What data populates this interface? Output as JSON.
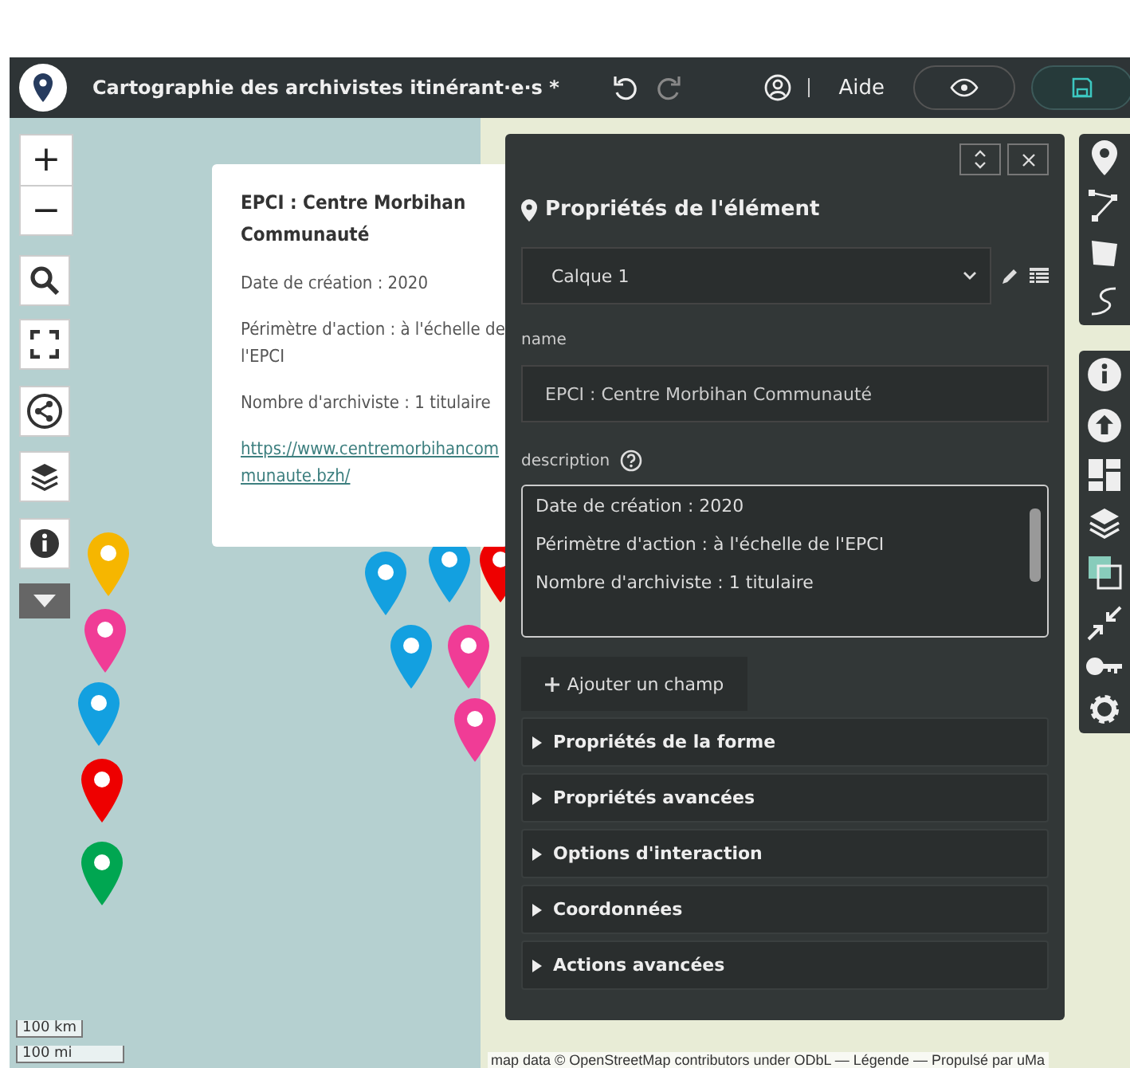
{
  "header": {
    "title": "Cartographie des archivistes itinérant·e·s *",
    "help": "Aide"
  },
  "map_controls": {
    "zoom_in": "+",
    "zoom_out": "−"
  },
  "popup": {
    "title": "EPCI : Centre Morbihan Communauté",
    "lines": [
      "Date de création : 2020",
      "Périmètre d'action : à l'échelle de l'EPCI",
      "Nombre d'archiviste : 1 titulaire"
    ],
    "link": "https://www.centremorbihancommunaute.bzh/"
  },
  "pins": [
    {
      "color": "#f6b600"
    },
    {
      "color": "#f03c96"
    },
    {
      "color": "#13a0e0"
    },
    {
      "color": "#ee0000"
    },
    {
      "color": "#00a651"
    },
    {
      "color": "#13a0e0"
    },
    {
      "color": "#13a0e0"
    },
    {
      "color": "#ee0000"
    },
    {
      "color": "#13a0e0"
    },
    {
      "color": "#f03c96"
    },
    {
      "color": "#f03c96"
    }
  ],
  "panel": {
    "title": "Propriétés de l'élément",
    "layer": "Calque 1",
    "name_label": "name",
    "name_value": "EPCI : Centre Morbihan Communauté",
    "description_label": "description",
    "description_lines": [
      "Date de création : 2020",
      "Périmètre d'action : à l'échelle de l'EPCI",
      "Nombre d'archiviste : 1 titulaire"
    ],
    "add_field": "Ajouter un champ",
    "sections": [
      {
        "label": "Propriétés de la forme",
        "expanded": false
      },
      {
        "label": "Propriétés avancées",
        "expanded": false
      },
      {
        "label": "Options d'interaction",
        "expanded": false
      },
      {
        "label": "Coordonnées",
        "expanded": false
      },
      {
        "label": "Actions avancées",
        "expanded": false
      }
    ]
  },
  "scale": [
    "100 km",
    "100 mi"
  ],
  "attribution": "map data © OpenStreetMap contributors under ODbL — Légende — Propulsé par uMa"
}
